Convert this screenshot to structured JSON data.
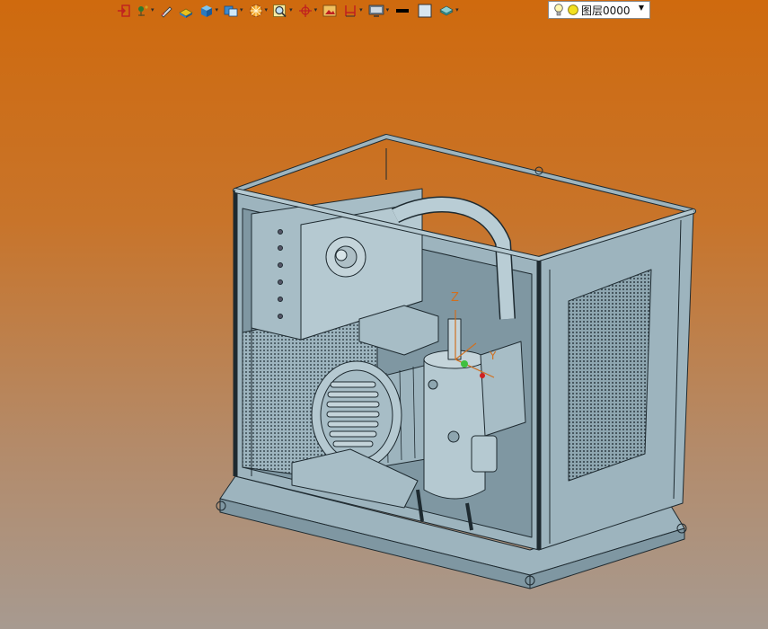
{
  "toolbar": {
    "buttons": [
      {
        "name": "exit-sketch-button",
        "icon": "exit-icon",
        "dropdown": false
      },
      {
        "name": "point-tool-button",
        "icon": "point-icon",
        "dropdown": true
      },
      {
        "name": "pen-tool-button",
        "icon": "pen-icon",
        "dropdown": false
      },
      {
        "name": "surface-button",
        "icon": "surface-icon",
        "dropdown": false
      },
      {
        "name": "solid-button",
        "icon": "solid-cube-icon",
        "dropdown": true
      },
      {
        "name": "view-cube-button",
        "icon": "view-cube-icon",
        "dropdown": true
      },
      {
        "name": "render-button",
        "icon": "render-icon",
        "dropdown": true
      },
      {
        "name": "magnifier-button",
        "icon": "magnifier-icon",
        "dropdown": true
      },
      {
        "name": "axis-button",
        "icon": "axis-icon",
        "dropdown": true
      },
      {
        "name": "image-button",
        "icon": "image-icon",
        "dropdown": false
      },
      {
        "name": "section-button",
        "icon": "section-icon",
        "dropdown": true
      },
      {
        "name": "display-button",
        "icon": "display-icon",
        "dropdown": true
      },
      {
        "name": "line-color-button",
        "icon": "line-swatch-icon",
        "dropdown": false
      },
      {
        "name": "fill-color-button",
        "icon": "fill-swatch-icon",
        "dropdown": false
      },
      {
        "name": "layer-manager-button",
        "icon": "layers-icon",
        "dropdown": true
      }
    ],
    "layer": {
      "label": "图层0000",
      "icons": [
        "bulb-icon",
        "sun-icon"
      ]
    }
  },
  "viewport": {
    "axis_label_z": "Z",
    "axis_label_y": "Y",
    "colors": {
      "model_fill": "#9db4be",
      "model_fill_dark": "#7f97a2",
      "model_edge": "#1e2a30",
      "axis_z": "#d07020"
    }
  }
}
